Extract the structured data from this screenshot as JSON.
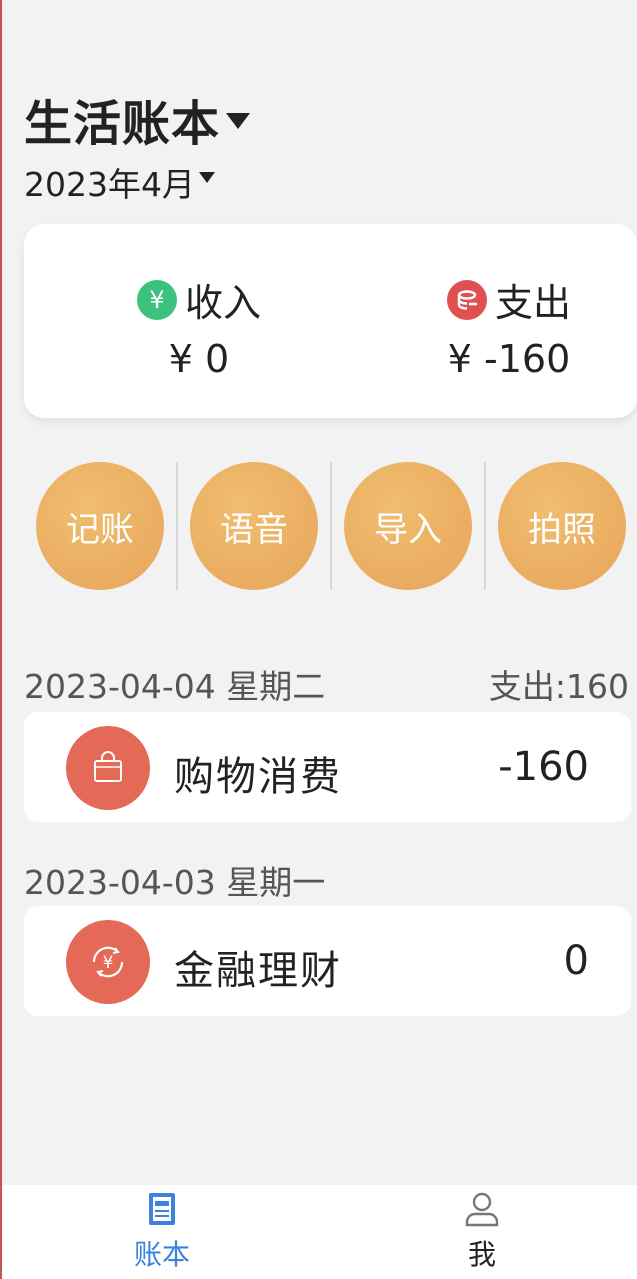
{
  "header": {
    "book_title": "生活账本",
    "month": "2023年4月"
  },
  "summary": {
    "income": {
      "label": "收入",
      "value": "¥ 0",
      "icon_glyph": "¥",
      "icon": "income-yen-icon",
      "color": "#3cc27e"
    },
    "expense": {
      "label": "支出",
      "value": "¥ -160",
      "icon_glyph": "⊖",
      "icon": "expense-coins-icon",
      "color": "#e05050"
    }
  },
  "actions": [
    {
      "label": "记账"
    },
    {
      "label": "语音"
    },
    {
      "label": "导入"
    },
    {
      "label": "拍照"
    }
  ],
  "days": [
    {
      "date": "2023-04-04 星期二",
      "total": "支出:160",
      "entries": [
        {
          "name": "购物消费",
          "amount": "-160",
          "icon": "shopping-bag-icon"
        }
      ]
    },
    {
      "date": "2023-04-03 星期一",
      "total": "",
      "entries": [
        {
          "name": "金融理财",
          "amount": "0",
          "icon": "finance-yen-cycle-icon"
        }
      ]
    }
  ],
  "tabbar": {
    "home": {
      "label": "账本",
      "icon": "ledger-icon",
      "active": true,
      "color": "#3d82df"
    },
    "me": {
      "label": "我",
      "icon": "user-icon",
      "active": false
    }
  }
}
